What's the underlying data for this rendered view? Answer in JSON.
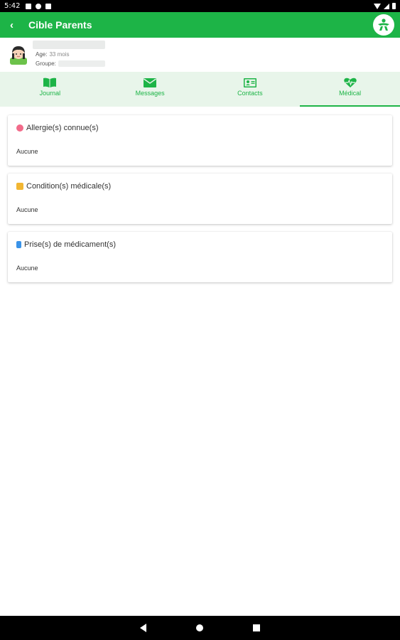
{
  "status_bar": {
    "time": "5:42"
  },
  "app_bar": {
    "back_glyph": "‹",
    "title": "Cible Parents"
  },
  "profile": {
    "age_label": "Age:",
    "age_value": "33 mois",
    "group_label": "Groupe:"
  },
  "tabs": [
    {
      "label": "Journal",
      "icon": "book-icon",
      "active": false
    },
    {
      "label": "Messages",
      "icon": "envelope-icon",
      "active": false
    },
    {
      "label": "Contacts",
      "icon": "contact-card-icon",
      "active": false
    },
    {
      "label": "Médical",
      "icon": "heartbeat-icon",
      "active": true
    }
  ],
  "cards": [
    {
      "title": "Allergie(s) connue(s)",
      "value": "Aucune",
      "icon": "allergy-icon",
      "icon_color": "#f26b8a"
    },
    {
      "title": "Condition(s) médicale(s)",
      "value": "Aucune",
      "icon": "condition-icon",
      "icon_color": "#f2b632"
    },
    {
      "title": "Prise(s) de médicament(s)",
      "value": "Aucune",
      "icon": "medication-icon",
      "icon_color": "#3a93e8"
    }
  ],
  "colors": {
    "brand_green": "#1db447",
    "tab_background": "#e8f5ea"
  }
}
